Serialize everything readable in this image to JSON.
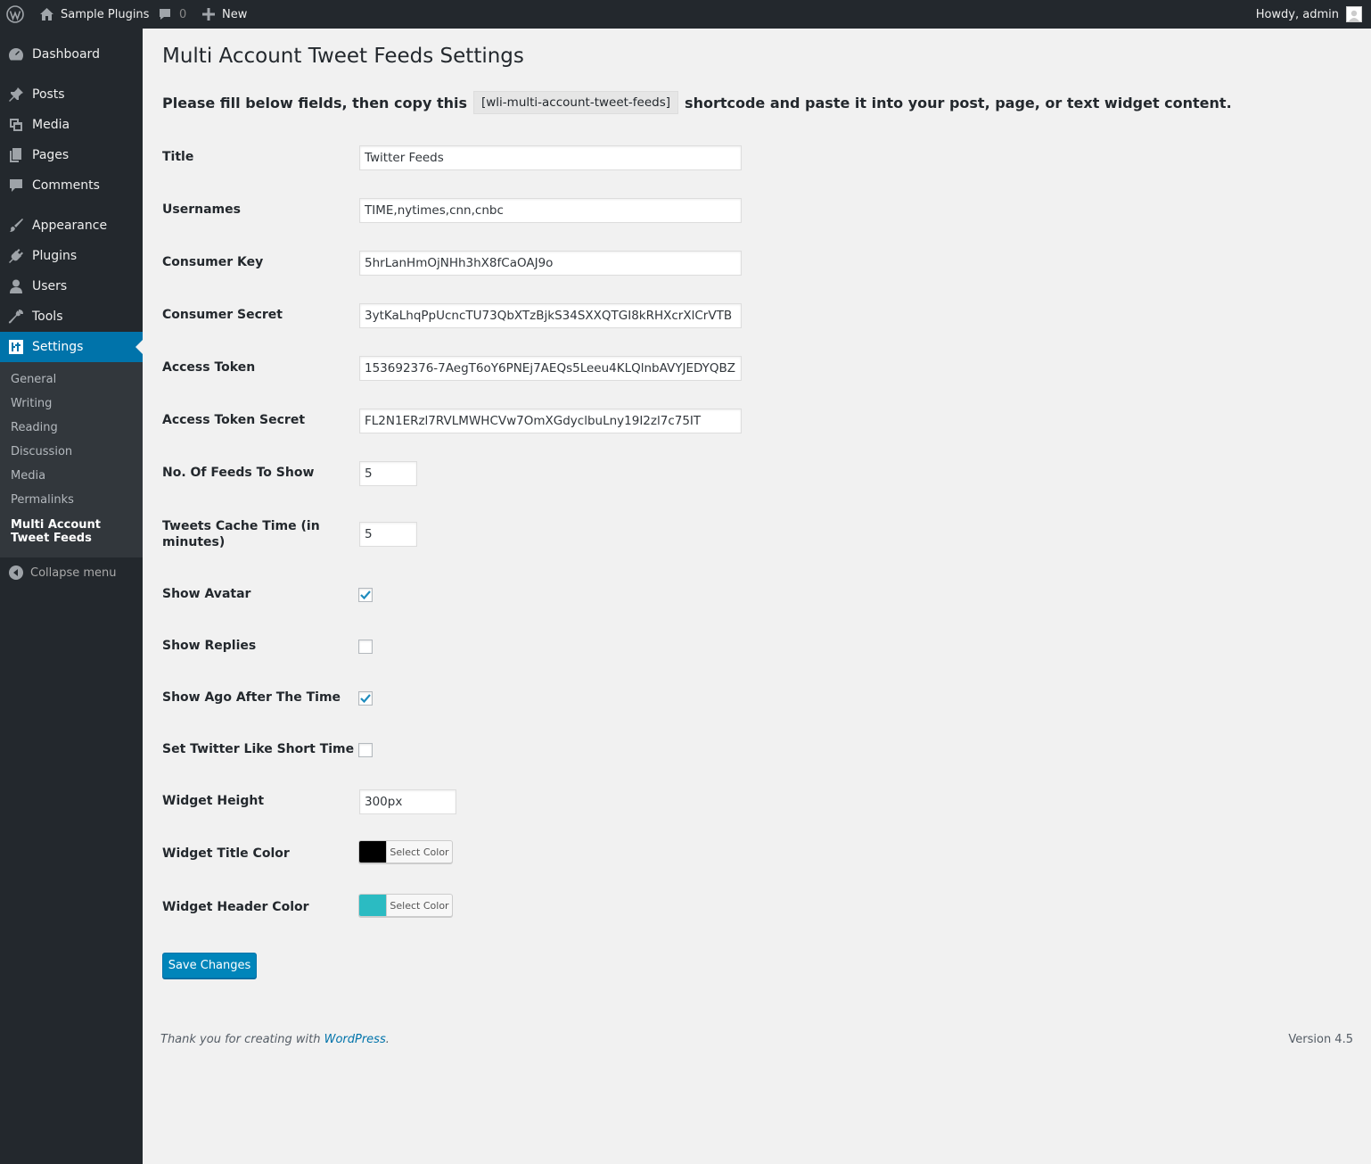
{
  "adminbar": {
    "site_name": "Sample Plugins",
    "comments_count": "0",
    "new_label": "New",
    "howdy": "Howdy, admin"
  },
  "sidebar": {
    "dashboard": "Dashboard",
    "posts": "Posts",
    "media": "Media",
    "pages": "Pages",
    "comments": "Comments",
    "appearance": "Appearance",
    "plugins": "Plugins",
    "users": "Users",
    "tools": "Tools",
    "settings": "Settings",
    "submenu": {
      "general": "General",
      "writing": "Writing",
      "reading": "Reading",
      "discussion": "Discussion",
      "media": "Media",
      "permalinks": "Permalinks",
      "multi_account": "Multi Account Tweet Feeds"
    },
    "collapse": "Collapse menu"
  },
  "page": {
    "title": "Multi Account Tweet Feeds Settings",
    "intro_before": "Please fill below fields, then copy this",
    "shortcode": "[wli-multi-account-tweet-feeds]",
    "intro_after": "shortcode and paste it into your post, page, or text widget content."
  },
  "form": {
    "title": {
      "label": "Title",
      "value": "Twitter Feeds"
    },
    "usernames": {
      "label": "Usernames",
      "value": "TIME,nytimes,cnn,cnbc"
    },
    "consumer_key": {
      "label": "Consumer Key",
      "value": "5hrLanHmOjNHh3hX8fCaOAJ9o"
    },
    "consumer_secret": {
      "label": "Consumer Secret",
      "value": "3ytKaLhqPpUcncTU73QbXTzBjkS34SXXQTGI8kRHXcrXlCrVTB"
    },
    "access_token": {
      "label": "Access Token",
      "value": "153692376-7AegT6oY6PNEj7AEQs5Leeu4KLQlnbAVYJEDYQBZ"
    },
    "access_token_secret": {
      "label": "Access Token Secret",
      "value": "FL2N1ERzl7RVLMWHCVw7OmXGdyclbuLny19I2zl7c75IT"
    },
    "feeds_count": {
      "label": "No. Of Feeds To Show",
      "value": "5"
    },
    "cache_time": {
      "label": "Tweets Cache Time (in minutes)",
      "value": "5"
    },
    "show_avatar": {
      "label": "Show Avatar",
      "checked": true
    },
    "show_replies": {
      "label": "Show Replies",
      "checked": false
    },
    "show_ago": {
      "label": "Show Ago After The Time",
      "checked": true
    },
    "short_time": {
      "label": "Set Twitter Like Short Time",
      "checked": false
    },
    "widget_height": {
      "label": "Widget Height",
      "value": "300px"
    },
    "widget_title_color": {
      "label": "Widget Title Color",
      "button": "Select Color",
      "color": "#000000"
    },
    "widget_header_color": {
      "label": "Widget Header Color",
      "button": "Select Color",
      "color": "#2bbbc2"
    },
    "save": "Save Changes"
  },
  "footer": {
    "thanks_before": "Thank you for creating with",
    "thanks_link": "WordPress",
    "thanks_after": ".",
    "version": "Version 4.5"
  },
  "colors": {
    "accent": "#0073aa",
    "button": "#0085ba",
    "adminbar": "#23282d"
  }
}
